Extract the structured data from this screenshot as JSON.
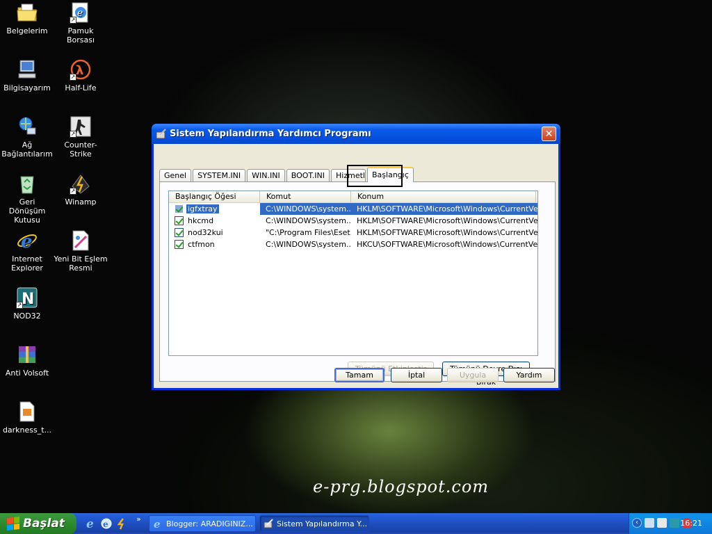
{
  "desktop": {
    "icons": [
      {
        "label": "Belgelerim",
        "icon": "documents-folder-icon"
      },
      {
        "label": "Pamuk Borsası",
        "icon": "internet-shortcut-icon"
      },
      {
        "label": "Bilgisayarım",
        "icon": "my-computer-icon"
      },
      {
        "label": "Half-Life",
        "icon": "half-life-icon"
      },
      {
        "label": "Ağ Bağlantılarım",
        "icon": "network-icon"
      },
      {
        "label": "Counter-Strike",
        "icon": "counter-strike-icon"
      },
      {
        "label": "Geri Dönüşüm Kutusu",
        "icon": "recycle-bin-icon"
      },
      {
        "label": "Winamp",
        "icon": "winamp-icon"
      },
      {
        "label": "Internet Explorer",
        "icon": "internet-explorer-icon"
      },
      {
        "label": "Yeni Bit Eşlem Resmi",
        "icon": "bitmap-image-icon"
      },
      {
        "label": "NOD32",
        "icon": "nod32-icon"
      },
      {
        "label": "Anti Volsoft",
        "icon": "archive-icon"
      },
      {
        "label": "darkness_t...",
        "icon": "image-file-icon"
      }
    ],
    "watermark": "e-prg.blogspot.com"
  },
  "window": {
    "title": "Sistem Yapılandırma Yardımcı Programı",
    "tabs": [
      {
        "label": "Genel"
      },
      {
        "label": "SYSTEM.INI"
      },
      {
        "label": "WIN.INI"
      },
      {
        "label": "BOOT.INI"
      },
      {
        "label": "Hizmetler"
      },
      {
        "label": "Başlangıç"
      }
    ],
    "list": {
      "columns": [
        "Başlangıç Öğesi",
        "Komut",
        "Konum"
      ],
      "rows": [
        {
          "item": "igfxtray",
          "command": "C:\\WINDOWS\\system...",
          "location": "HKLM\\SOFTWARE\\Microsoft\\Windows\\CurrentVer..."
        },
        {
          "item": "hkcmd",
          "command": "C:\\WINDOWS\\system...",
          "location": "HKLM\\SOFTWARE\\Microsoft\\Windows\\CurrentVer..."
        },
        {
          "item": "nod32kui",
          "command": "\"C:\\Program Files\\Eset...",
          "location": "HKLM\\SOFTWARE\\Microsoft\\Windows\\CurrentVer..."
        },
        {
          "item": "ctfmon",
          "command": "C:\\WINDOWS\\system...",
          "location": "HKCU\\SOFTWARE\\Microsoft\\Windows\\CurrentVer..."
        }
      ]
    },
    "buttons": {
      "enable_all": "Tümünü Etkinleştir",
      "disable_all": "Tümünü Devre Dışı Bırak",
      "ok": "Tamam",
      "cancel": "İptal",
      "apply": "Uygula",
      "help": "Yardım"
    }
  },
  "taskbar": {
    "start_label": "Başlat",
    "quick_launch_more": "»",
    "tasks": [
      {
        "label": "Blogger: ARADIGINIZ..."
      },
      {
        "label": "Sistem Yapılandırma Y..."
      }
    ],
    "clock": "16:21"
  },
  "colors": {
    "titlebar": "#0a5ae8",
    "selection": "#316ac5",
    "taskbar": "#245edb",
    "start_button": "#2e8b2e"
  }
}
